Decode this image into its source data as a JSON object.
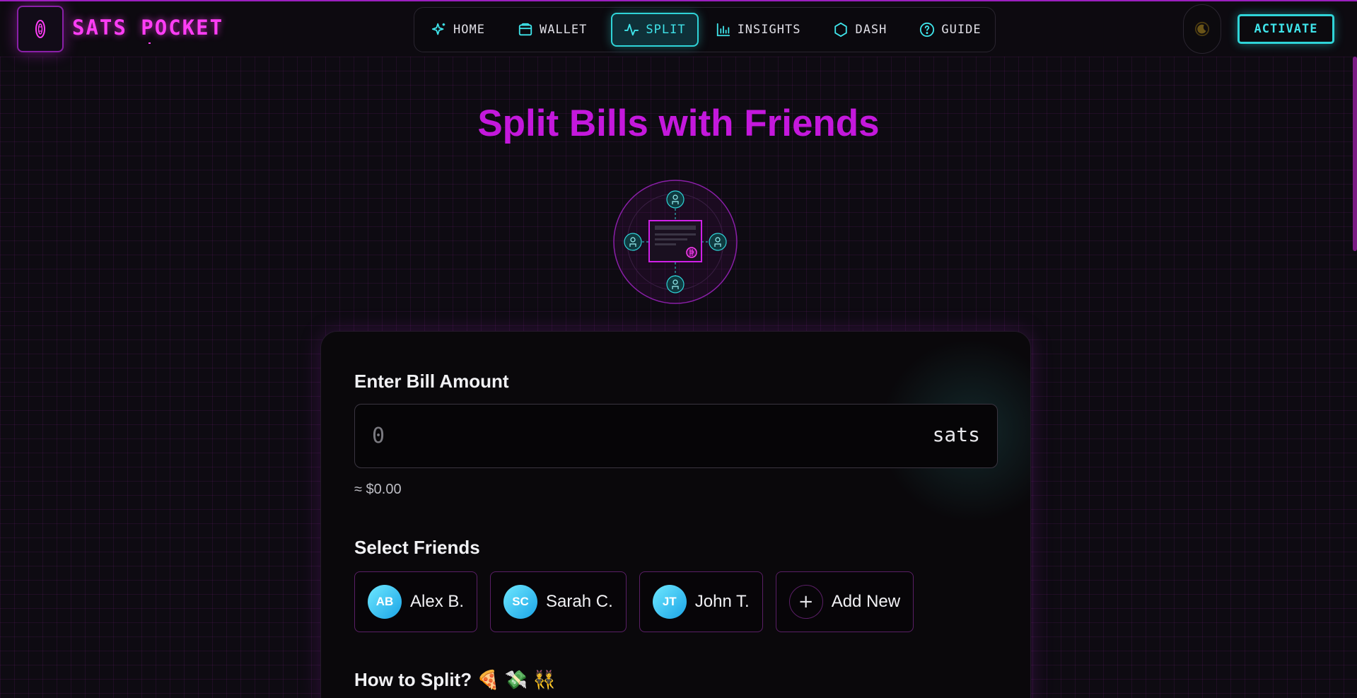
{
  "app": {
    "name": "SATS POCKET"
  },
  "nav": {
    "items": [
      {
        "label": "HOME",
        "icon": "sparkles-icon"
      },
      {
        "label": "WALLET",
        "icon": "wallet-icon"
      },
      {
        "label": "SPLIT",
        "icon": "activity-icon",
        "active": true
      },
      {
        "label": "INSIGHTS",
        "icon": "bar-chart-icon"
      },
      {
        "label": "DASH",
        "icon": "hexagon-icon"
      },
      {
        "label": "GUIDE",
        "icon": "help-circle-icon"
      }
    ]
  },
  "header": {
    "theme_icon": "moon-icon",
    "activate_label": "ACTIVATE"
  },
  "page": {
    "title": "Split Bills with Friends"
  },
  "bill": {
    "label": "Enter Bill Amount",
    "placeholder": "0",
    "value": "",
    "unit": "sats",
    "fiat_estimate": "≈ $0.00"
  },
  "friends": {
    "label": "Select Friends",
    "list": [
      {
        "initials": "AB",
        "name": "Alex B."
      },
      {
        "initials": "SC",
        "name": "Sarah C."
      },
      {
        "initials": "JT",
        "name": "John T."
      }
    ],
    "add_label": "Add New"
  },
  "split": {
    "label": "How to Split? 🍕 💸 👯"
  },
  "colors": {
    "accent_magenta": "#c418dc",
    "accent_pink": "#ff3df5",
    "accent_cyan": "#2fd4d8",
    "background": "#0e0b12"
  }
}
